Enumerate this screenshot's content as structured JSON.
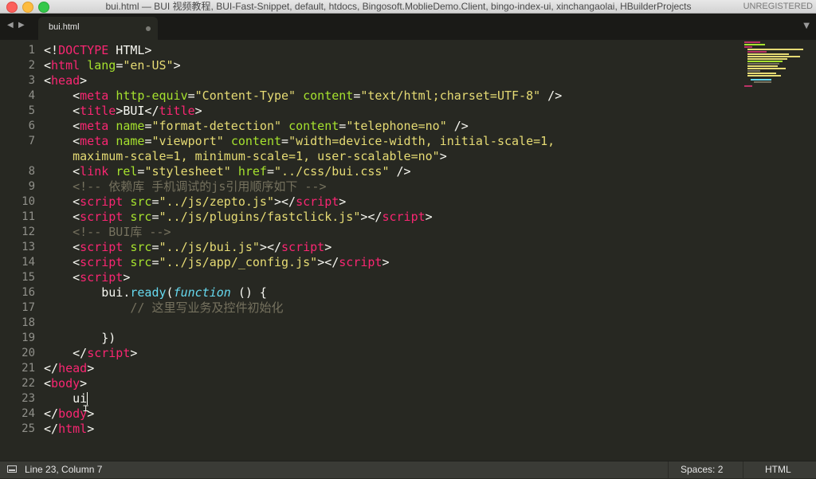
{
  "window": {
    "title": "bui.html — BUI 视频教程, BUI-Fast-Snippet, default, htdocs, Bingosoft.MoblieDemo.Client, bingo-index-ui, xinchangaolai, HBuilderProjects",
    "unregistered": "UNREGISTERED"
  },
  "tabs": {
    "active_label": "bui.html",
    "nav_left": "◀",
    "nav_right": "▶",
    "menu_glyph": "▼"
  },
  "editor": {
    "line_numbers": [
      "1",
      "2",
      "3",
      "4",
      "5",
      "6",
      "7",
      "",
      "8",
      "9",
      "10",
      "11",
      "12",
      "13",
      "14",
      "15",
      "16",
      "17",
      "18",
      "19",
      "20",
      "21",
      "22",
      "23",
      "24",
      "25"
    ],
    "lines": [
      [
        [
          "p",
          "<!"
        ],
        [
          "t",
          "DOCTYPE"
        ],
        [
          "p",
          " HTML>"
        ]
      ],
      [
        [
          "p",
          "<"
        ],
        [
          "t",
          "html"
        ],
        [
          "p",
          " "
        ],
        [
          "a",
          "lang"
        ],
        [
          "p",
          "="
        ],
        [
          "s",
          "\"en-US\""
        ],
        [
          "p",
          ">"
        ]
      ],
      [
        [
          "p",
          "<"
        ],
        [
          "t",
          "head"
        ],
        [
          "p",
          ">"
        ]
      ],
      [
        [
          "p",
          "    <"
        ],
        [
          "t",
          "meta"
        ],
        [
          "p",
          " "
        ],
        [
          "a",
          "http-equiv"
        ],
        [
          "p",
          "="
        ],
        [
          "s",
          "\"Content-Type\""
        ],
        [
          "p",
          " "
        ],
        [
          "a",
          "content"
        ],
        [
          "p",
          "="
        ],
        [
          "s",
          "\"text/html;charset=UTF-8\""
        ],
        [
          "p",
          " />"
        ]
      ],
      [
        [
          "p",
          "    <"
        ],
        [
          "t",
          "title"
        ],
        [
          "p",
          ">BUI</"
        ],
        [
          "t",
          "title"
        ],
        [
          "p",
          ">"
        ]
      ],
      [
        [
          "p",
          "    <"
        ],
        [
          "t",
          "meta"
        ],
        [
          "p",
          " "
        ],
        [
          "a",
          "name"
        ],
        [
          "p",
          "="
        ],
        [
          "s",
          "\"format-detection\""
        ],
        [
          "p",
          " "
        ],
        [
          "a",
          "content"
        ],
        [
          "p",
          "="
        ],
        [
          "s",
          "\"telephone=no\""
        ],
        [
          "p",
          " />"
        ]
      ],
      [
        [
          "p",
          "    <"
        ],
        [
          "t",
          "meta"
        ],
        [
          "p",
          " "
        ],
        [
          "a",
          "name"
        ],
        [
          "p",
          "="
        ],
        [
          "s",
          "\"viewport\""
        ],
        [
          "p",
          " "
        ],
        [
          "a",
          "content"
        ],
        [
          "p",
          "="
        ],
        [
          "s",
          "\"width=device-width, initial-scale=1,"
        ]
      ],
      [
        [
          "s",
          "    maximum-scale=1, minimum-scale=1, user-scalable=no\""
        ],
        [
          "p",
          ">"
        ]
      ],
      [
        [
          "p",
          "    <"
        ],
        [
          "t",
          "link"
        ],
        [
          "p",
          " "
        ],
        [
          "a",
          "rel"
        ],
        [
          "p",
          "="
        ],
        [
          "s",
          "\"stylesheet\""
        ],
        [
          "p",
          " "
        ],
        [
          "a",
          "href"
        ],
        [
          "p",
          "="
        ],
        [
          "s",
          "\"../css/bui.css\""
        ],
        [
          "p",
          " />"
        ]
      ],
      [
        [
          "c",
          "    <!-- 依赖库 手机调试的js引用顺序如下 -->"
        ]
      ],
      [
        [
          "p",
          "    <"
        ],
        [
          "t",
          "script"
        ],
        [
          "p",
          " "
        ],
        [
          "a",
          "src"
        ],
        [
          "p",
          "="
        ],
        [
          "s",
          "\"../js/zepto.js\""
        ],
        [
          "p",
          "></"
        ],
        [
          "t",
          "script"
        ],
        [
          "p",
          ">"
        ]
      ],
      [
        [
          "p",
          "    <"
        ],
        [
          "t",
          "script"
        ],
        [
          "p",
          " "
        ],
        [
          "a",
          "src"
        ],
        [
          "p",
          "="
        ],
        [
          "s",
          "\"../js/plugins/fastclick.js\""
        ],
        [
          "p",
          "></"
        ],
        [
          "t",
          "script"
        ],
        [
          "p",
          ">"
        ]
      ],
      [
        [
          "c",
          "    <!-- BUI库 -->"
        ]
      ],
      [
        [
          "p",
          "    <"
        ],
        [
          "t",
          "script"
        ],
        [
          "p",
          " "
        ],
        [
          "a",
          "src"
        ],
        [
          "p",
          "="
        ],
        [
          "s",
          "\"../js/bui.js\""
        ],
        [
          "p",
          "></"
        ],
        [
          "t",
          "script"
        ],
        [
          "p",
          ">"
        ]
      ],
      [
        [
          "p",
          "    <"
        ],
        [
          "t",
          "script"
        ],
        [
          "p",
          " "
        ],
        [
          "a",
          "src"
        ],
        [
          "p",
          "="
        ],
        [
          "s",
          "\"../js/app/_config.js\""
        ],
        [
          "p",
          "></"
        ],
        [
          "t",
          "script"
        ],
        [
          "p",
          ">"
        ]
      ],
      [
        [
          "p",
          "    <"
        ],
        [
          "t",
          "script"
        ],
        [
          "p",
          ">"
        ]
      ],
      [
        [
          "p",
          "        bui."
        ],
        [
          "f",
          "ready"
        ],
        [
          "p",
          "("
        ],
        [
          "fi",
          "function"
        ],
        [
          "p",
          " () {"
        ]
      ],
      [
        [
          "c",
          "            // 这里写业务及控件初始化"
        ]
      ],
      [
        [
          "p",
          ""
        ]
      ],
      [
        [
          "p",
          "        })"
        ]
      ],
      [
        [
          "p",
          "    </"
        ],
        [
          "t",
          "script"
        ],
        [
          "p",
          ">"
        ]
      ],
      [
        [
          "p",
          "</"
        ],
        [
          "t",
          "head"
        ],
        [
          "p",
          ">"
        ]
      ],
      [
        [
          "p",
          "<"
        ],
        [
          "t",
          "body"
        ],
        [
          "p",
          ">"
        ]
      ],
      [
        [
          "p",
          "    ui"
        ],
        [
          "caret",
          ""
        ]
      ],
      [
        [
          "p",
          "</"
        ],
        [
          "t",
          "body"
        ],
        [
          "p",
          ">"
        ]
      ],
      [
        [
          "p",
          "</"
        ],
        [
          "t",
          "html"
        ],
        [
          "p",
          ">"
        ]
      ]
    ],
    "mouse_cursor_glyph": "⌶"
  },
  "colors": {
    "background": "#272822",
    "tag": "#f92672",
    "attribute": "#a6e22e",
    "string": "#e6db74",
    "comment": "#75715e",
    "function": "#66d9ef"
  },
  "status": {
    "position": "Line 23, Column 7",
    "spaces": "Spaces: 2",
    "syntax": "HTML"
  }
}
